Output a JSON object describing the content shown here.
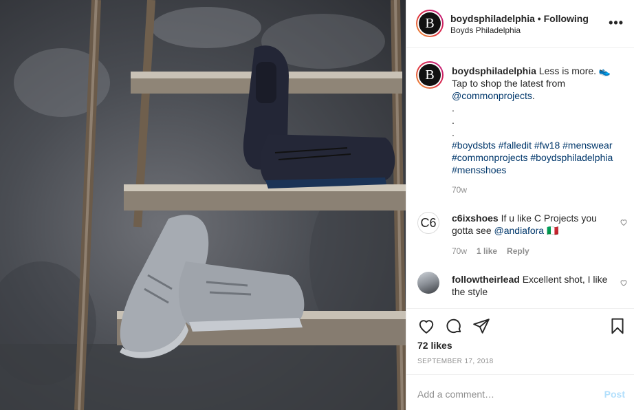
{
  "header": {
    "username": "boydsphiladelphia",
    "separator": "•",
    "follow_status": "Following",
    "location": "Boyds Philadelphia",
    "avatar_letter": "B",
    "more_label": "•••"
  },
  "caption": {
    "username": "boydsphiladelphia",
    "text": "Less is more. 👟 Tap to shop the latest from",
    "mention": "@commonprojects",
    "mention_suffix": ".",
    "dot1": ".",
    "dot2": ".",
    "dot3": ".",
    "hashtags": [
      "#boydsbts",
      "#falledit",
      "#fw18",
      "#menswear",
      "#commonprojects",
      "#boydsphiladelphia",
      "#mensshoes"
    ],
    "time": "70w"
  },
  "comments": [
    {
      "username": "c6ixshoes",
      "avatar_text": "C6",
      "text": "If u like C Projects you gotta see",
      "mention": "@andiafora",
      "emoji": "🇮🇹",
      "time": "70w",
      "likes": "1 like",
      "reply": "Reply"
    },
    {
      "username": "followtheirlead",
      "text": "Excellent shot, I like the style"
    }
  ],
  "post": {
    "likes": "72 likes",
    "date": "SEPTEMBER 17, 2018"
  },
  "add_comment": {
    "placeholder": "Add a comment…",
    "post_label": "Post"
  },
  "photo": {
    "description_icon": "photo-image"
  }
}
